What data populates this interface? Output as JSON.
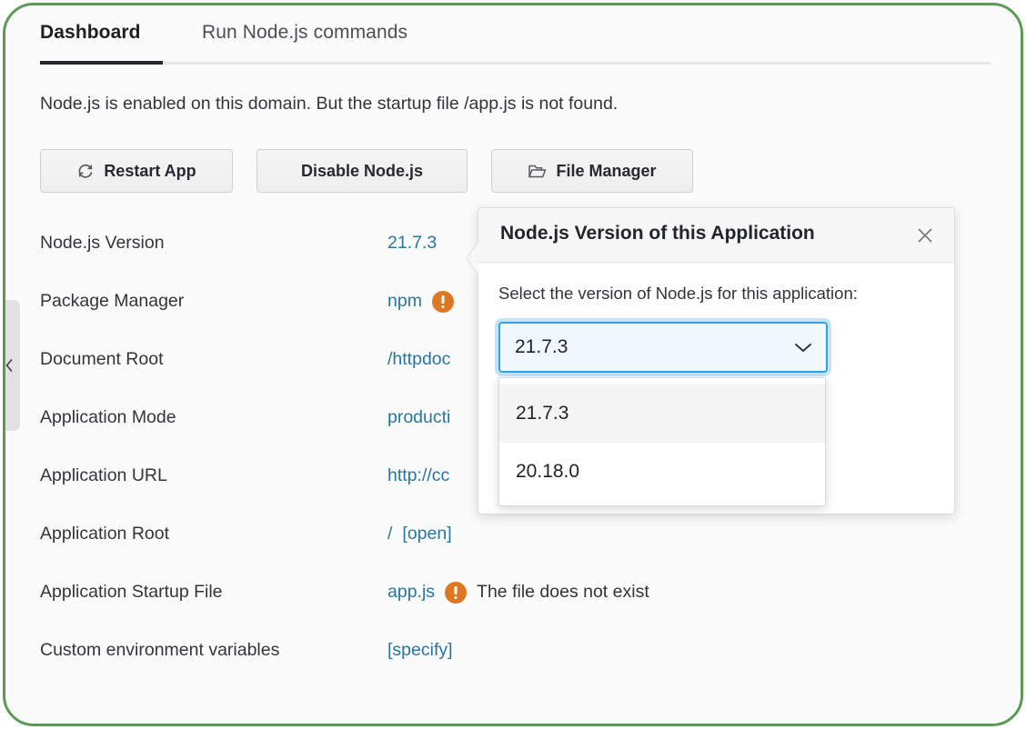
{
  "theme": {
    "frame_border": "#5a9a55",
    "link": "#2577A1",
    "warning": "#DD7722",
    "accent_focus": "#3AA0DD",
    "active_tab_underline": "#24272B"
  },
  "tabs": [
    {
      "label": "Dashboard",
      "active": true
    },
    {
      "label": "Run Node.js commands",
      "active": false
    }
  ],
  "intro": "Node.js is enabled on this domain. But the startup file /app.js is not found.",
  "toolbar": {
    "restart_label": "Restart App",
    "restart_icon": "refresh-icon",
    "disable_label": "Disable Node.js",
    "file_manager_label": "File Manager",
    "file_manager_icon": "folder-icon"
  },
  "rows": [
    {
      "label": "Node.js Version",
      "value": "21.7.3",
      "value_kind": "link"
    },
    {
      "label": "Package Manager",
      "value": "npm",
      "value_kind": "link",
      "warning": true
    },
    {
      "label": "Document Root",
      "value": "/httpdoc",
      "value_kind": "link"
    },
    {
      "label": "Application Mode",
      "value": "producti",
      "value_kind": "link"
    },
    {
      "label": "Application URL",
      "value": "http://cc",
      "value_kind": "link"
    },
    {
      "label": "Application Root",
      "value": "/",
      "value_kind": "link",
      "action": "[open]"
    },
    {
      "label": "Application Startup File",
      "value": "app.js",
      "value_kind": "link",
      "warning": true,
      "note": "The file does not exist"
    },
    {
      "label": "Custom environment variables",
      "value": "[specify]",
      "value_kind": "link"
    }
  ],
  "sidebar": {
    "collapse_icon": "chevron-left-icon"
  },
  "popover": {
    "title": "Node.js Version of this Application",
    "close_icon": "close-icon",
    "sublabel": "Select the version of Node.js for this application:",
    "select": {
      "value": "21.7.3",
      "chevron_icon": "chevron-down-icon",
      "options": [
        {
          "label": "21.7.3",
          "highlighted": true
        },
        {
          "label": "20.18.0",
          "highlighted": false
        }
      ]
    }
  }
}
